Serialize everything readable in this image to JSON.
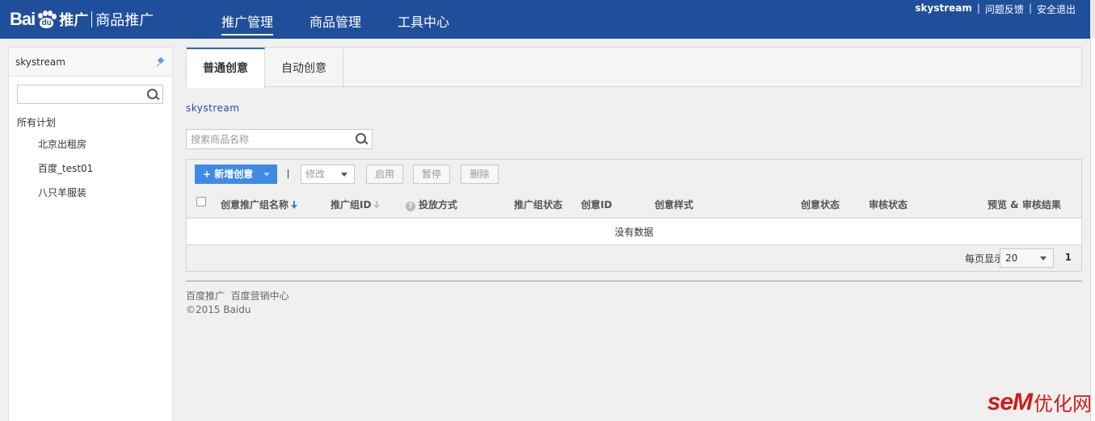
{
  "header": {
    "logo": {
      "latin": "Bai",
      "paw_text": "du",
      "cn": "推广",
      "product": "商品推广"
    },
    "nav": [
      {
        "label": "推广管理",
        "active": true
      },
      {
        "label": "商品管理",
        "active": false
      },
      {
        "label": "工具中心",
        "active": false
      }
    ],
    "user": "skystream",
    "links": {
      "feedback": "问题反馈",
      "logout": "安全退出"
    },
    "separator": "|"
  },
  "sidebar": {
    "title": "skystream",
    "search_value": "",
    "tree_root": "所有计划",
    "plans": [
      "北京出租房",
      "百度_test01",
      "八只羊服装"
    ]
  },
  "tabs": [
    {
      "label": "普通创意",
      "active": true
    },
    {
      "label": "自动创意",
      "active": false
    }
  ],
  "account": "skystream",
  "product_search": {
    "placeholder": "搜索商品名称",
    "value": ""
  },
  "toolbar": {
    "new_label": "+ 新增创意",
    "divider": "|",
    "edit_label": "修改",
    "enable_label": "启用",
    "pause_label": "暂停",
    "delete_label": "删除"
  },
  "table": {
    "columns": [
      "创意推广组名称",
      "推广组ID",
      "投放方式",
      "推广组状态",
      "创意ID",
      "创意样式",
      "创意状态",
      "审核状态",
      "预览 & 审核结果"
    ],
    "empty_text": "没有数据"
  },
  "pager": {
    "per_page_label": "每页显示",
    "page_size": "20",
    "current_page": "1"
  },
  "footer": {
    "links": "百度推广  百度营销中心",
    "copyright": "©2015 Baidu"
  },
  "watermark": {
    "latin": "seM",
    "cn": "优化网"
  },
  "colors": {
    "header": "#1f4f9b",
    "accent": "#3f8be4",
    "link": "#1a4fa3",
    "watermark": "#d21a1a"
  },
  "icons": {
    "search": "search-icon",
    "pin": "pin-icon",
    "sort": "sort-down-icon",
    "help": "help-icon"
  }
}
